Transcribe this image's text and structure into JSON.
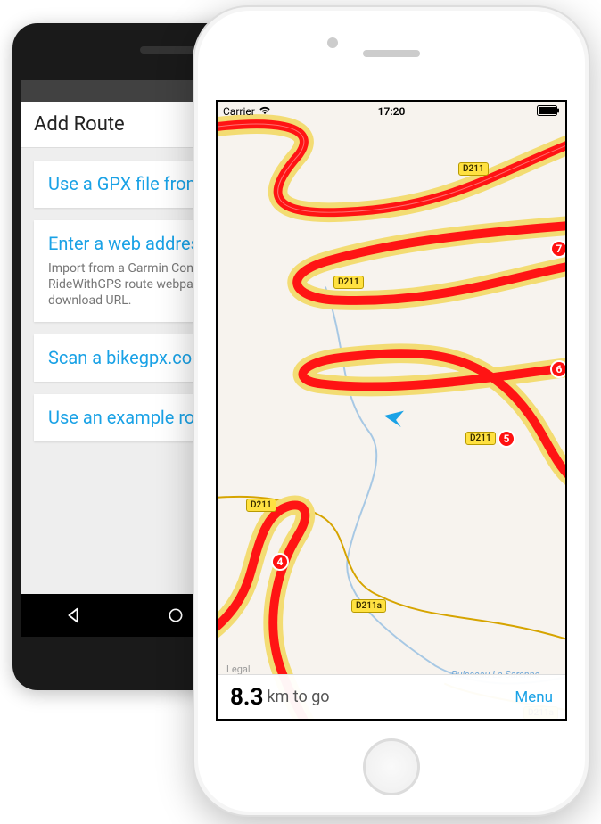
{
  "android": {
    "title": "Add Route",
    "cards": [
      {
        "title": "Use a GPX file from your PC",
        "sub": ""
      },
      {
        "title": "Enter a web address",
        "sub": "Import from a Garmin Connect, Strava, RideWithGPS route webpage. Or a direct GPX download URL."
      },
      {
        "title": "Scan a bikegpx.com barcode",
        "sub": ""
      },
      {
        "title": "Use an example route",
        "sub": ""
      }
    ]
  },
  "ios": {
    "statusbar": {
      "carrier": "Carrier",
      "time": "17:20"
    },
    "roads": {
      "d211": "D211",
      "d211a": "D211a"
    },
    "markers": {
      "m4": "4",
      "m5": "5",
      "m6": "6",
      "m7": "7"
    },
    "places": {
      "legal": "Legal"
    },
    "rivers": {
      "sarenne": "Ruisseau La Sarenne"
    },
    "bottom": {
      "distance_value": "8.3",
      "distance_label": "km to go",
      "menu": "Menu"
    }
  }
}
